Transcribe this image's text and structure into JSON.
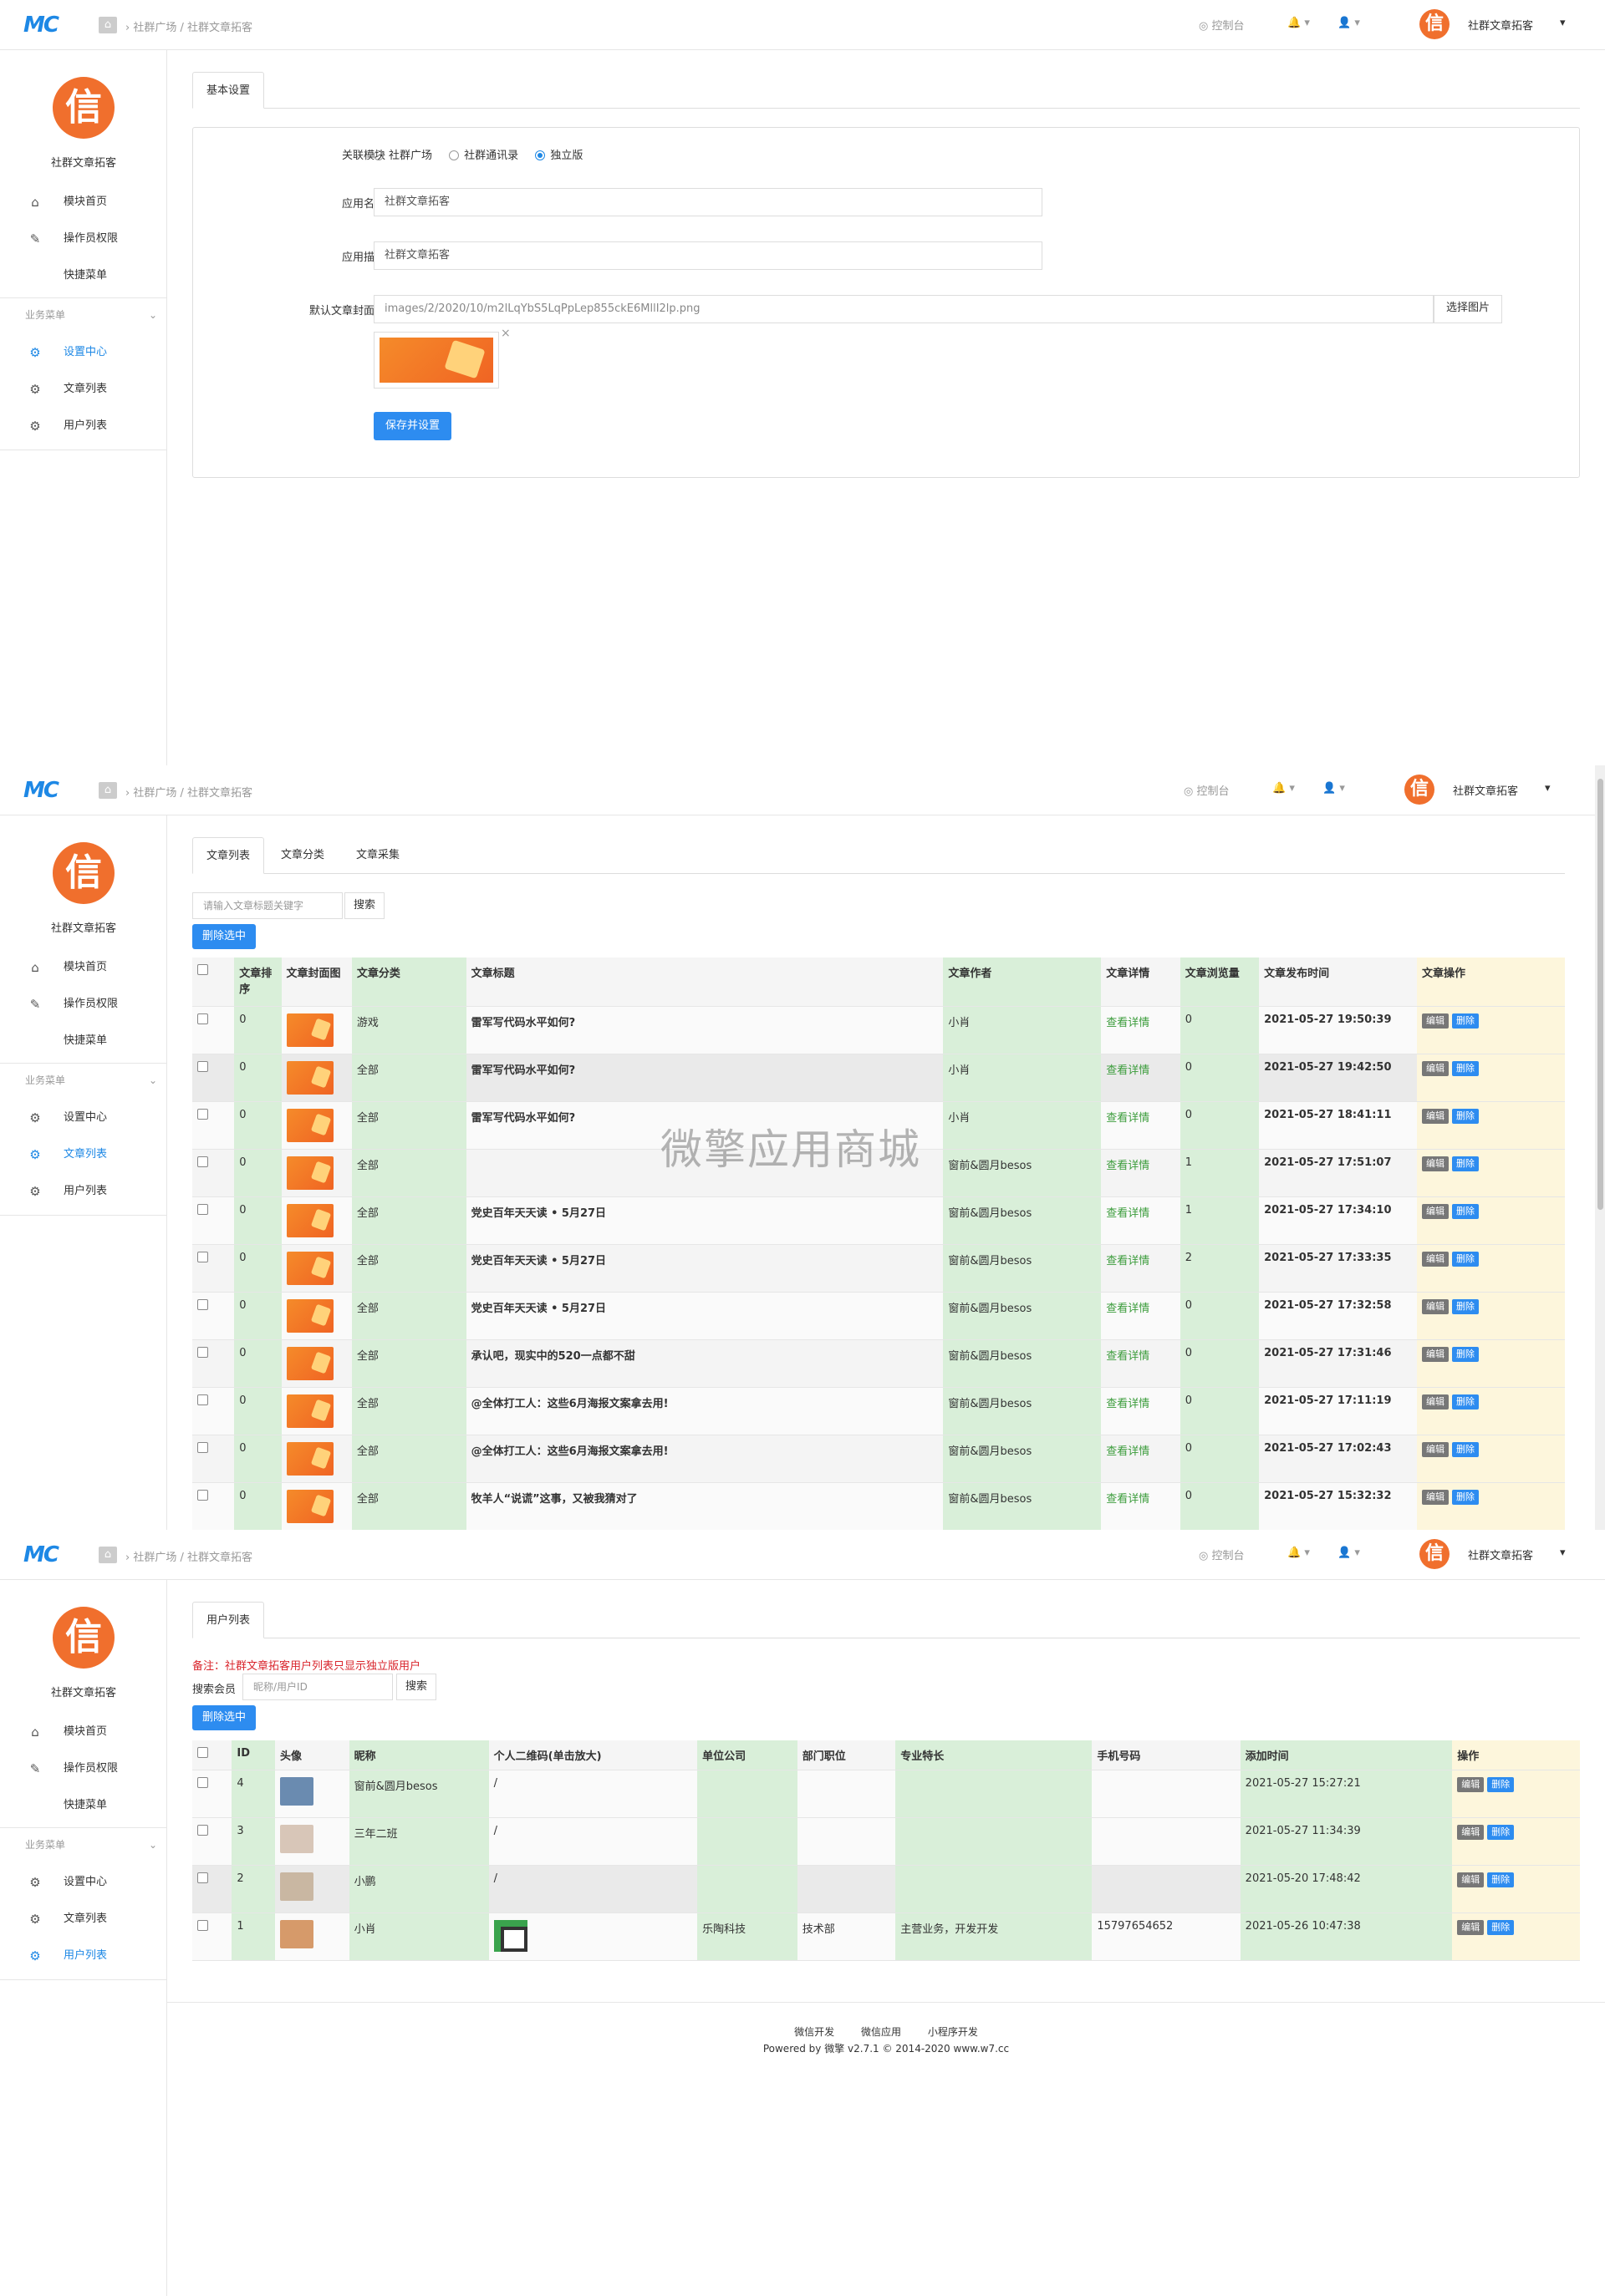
{
  "brand": {
    "logo": "MC",
    "avatar_char": "信",
    "app_name": "社群文章拓客"
  },
  "header": {
    "breadcrumb": "社群广场 / 社群文章拓客",
    "console": "控制台",
    "user_name": "社群文章拓客"
  },
  "sidebar": {
    "items": [
      {
        "label": "模块首页",
        "icon": "home-icon"
      },
      {
        "label": "操作员权限",
        "icon": "edit-icon"
      },
      {
        "label": "快捷菜单",
        "icon": ""
      }
    ],
    "section": "业务菜单",
    "biz": [
      {
        "label": "设置中心",
        "icon": "gear-icon"
      },
      {
        "label": "文章列表",
        "icon": "gear-icon"
      },
      {
        "label": "用户列表",
        "icon": "gear-icon"
      }
    ]
  },
  "settings": {
    "tab": "基本设置",
    "module_label": "关联模块",
    "module_options": [
      "社群广场",
      "社群通讯录",
      "独立版"
    ],
    "module_selected": "独立版",
    "name_label": "应用名称",
    "name_value": "社群文章拓客",
    "desc_label": "应用描述",
    "desc_value": "社群文章拓客",
    "cover_label": "默认文章封面图",
    "cover_value": "images/2/2020/10/m2lLqYbS5LqPpLep855ckE6MllI2lp.png",
    "choose_btn": "选择图片",
    "save_btn": "保存并设置"
  },
  "articles": {
    "tabs": [
      "文章列表",
      "文章分类",
      "文章采集"
    ],
    "search_placeholder": "请输入文章标题关键字",
    "search_btn": "搜索",
    "delete_btn": "删除选中",
    "columns": [
      "文章排序",
      "文章封面图",
      "文章分类",
      "文章标题",
      "文章作者",
      "文章详情",
      "文章浏览量",
      "文章发布时间",
      "文章操作"
    ],
    "detail_link": "查看详情",
    "edit": "编辑",
    "del": "删除",
    "rows": [
      {
        "sort": "0",
        "cat": "游戏",
        "title": "雷军写代码水平如何?",
        "author": "小肖",
        "views": "0",
        "time": "2021-05-27 19:50:39"
      },
      {
        "sort": "0",
        "cat": "全部",
        "title": "雷军写代码水平如何?",
        "author": "小肖",
        "views": "0",
        "time": "2021-05-27 19:42:50"
      },
      {
        "sort": "0",
        "cat": "全部",
        "title": "雷军写代码水平如何?",
        "author": "小肖",
        "views": "0",
        "time": "2021-05-27 18:41:11"
      },
      {
        "sort": "0",
        "cat": "全部",
        "title": "",
        "author": "窗前&圆月besos",
        "views": "1",
        "time": "2021-05-27 17:51:07"
      },
      {
        "sort": "0",
        "cat": "全部",
        "title": "党史百年天天读 • 5月27日",
        "author": "窗前&圆月besos",
        "views": "1",
        "time": "2021-05-27 17:34:10"
      },
      {
        "sort": "0",
        "cat": "全部",
        "title": "党史百年天天读 • 5月27日",
        "author": "窗前&圆月besos",
        "views": "2",
        "time": "2021-05-27 17:33:35"
      },
      {
        "sort": "0",
        "cat": "全部",
        "title": "党史百年天天读 • 5月27日",
        "author": "窗前&圆月besos",
        "views": "0",
        "time": "2021-05-27 17:32:58"
      },
      {
        "sort": "0",
        "cat": "全部",
        "title": "承认吧，现实中的520一点都不甜",
        "author": "窗前&圆月besos",
        "views": "0",
        "time": "2021-05-27 17:31:46"
      },
      {
        "sort": "0",
        "cat": "全部",
        "title": "@全体打工人：这些6月海报文案拿去用!",
        "author": "窗前&圆月besos",
        "views": "0",
        "time": "2021-05-27 17:11:19"
      },
      {
        "sort": "0",
        "cat": "全部",
        "title": "@全体打工人：这些6月海报文案拿去用!",
        "author": "窗前&圆月besos",
        "views": "0",
        "time": "2021-05-27 17:02:43"
      },
      {
        "sort": "0",
        "cat": "全部",
        "title": "牧羊人“说谎”这事，又被我猜对了",
        "author": "窗前&圆月besos",
        "views": "0",
        "time": "2021-05-27 15:32:32"
      }
    ],
    "watermark": "微擎应用商城"
  },
  "users": {
    "tab": "用户列表",
    "note": "备注：社群文章拓客用户列表只显示独立版用户",
    "search_label": "搜索会员",
    "search_placeholder": "昵称/用户ID",
    "search_btn": "搜索",
    "delete_btn": "删除选中",
    "columns": [
      "ID",
      "头像",
      "昵称",
      "个人二维码(单击放大)",
      "单位公司",
      "部门职位",
      "专业特长",
      "手机号码",
      "添加时间",
      "操作"
    ],
    "edit": "编辑",
    "del": "删除",
    "rows": [
      {
        "id": "4",
        "nick": "窗前&圆月besos",
        "qr": "/",
        "company": "",
        "dept": "",
        "skill": "",
        "phone": "",
        "time": "2021-05-27 15:27:21",
        "avatar_color": "#6a8bb0"
      },
      {
        "id": "3",
        "nick": "三年二班",
        "qr": "/",
        "company": "",
        "dept": "",
        "skill": "",
        "phone": "",
        "time": "2021-05-27 11:34:39",
        "avatar_color": "#d8c6b8"
      },
      {
        "id": "2",
        "nick": "小鹏",
        "qr": "/",
        "company": "",
        "dept": "",
        "skill": "",
        "phone": "",
        "time": "2021-05-20 17:48:42",
        "avatar_color": "#c9b7a2"
      },
      {
        "id": "1",
        "nick": "小肖",
        "qr": "",
        "company": "乐陶科技",
        "dept": "技术部",
        "skill": "主营业务，开发开发",
        "phone": "15797654652",
        "time": "2021-05-26 10:47:38",
        "avatar_color": "#d69a6a"
      }
    ]
  },
  "footer": {
    "links": [
      "微信开发",
      "微信应用",
      "小程序开发"
    ],
    "powered": "Powered by 微擎 v2.7.1 © 2014-2020 www.w7.cc"
  }
}
